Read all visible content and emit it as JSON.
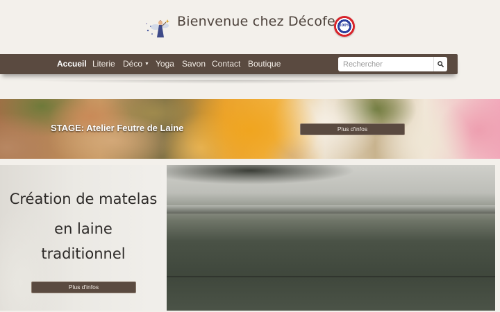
{
  "header": {
    "site_title": "Bienvenue chez Décofee",
    "logo_icon": "fairy-logo-icon",
    "badge_icon": "made-in-france-badge-icon",
    "badge_text": "100%"
  },
  "navbar": {
    "items": [
      {
        "label": "Accueil",
        "active": true
      },
      {
        "label": "Literie",
        "active": false
      },
      {
        "label": "Déco",
        "active": false,
        "has_dropdown": true
      },
      {
        "label": "Yoga",
        "active": false
      },
      {
        "label": "Savon",
        "active": false
      },
      {
        "label": "Contact",
        "active": false
      },
      {
        "label": "Boutique",
        "active": false
      }
    ],
    "search": {
      "placeholder": "Rechercher",
      "value": "",
      "icon": "search-icon"
    }
  },
  "banners": {
    "stage": {
      "label": "STAGE:  Atelier Feutre de Laine",
      "button": "Plus d'infos"
    },
    "matelas": {
      "lines": [
        "Création de matelas",
        "en laine",
        "traditionnel"
      ],
      "button": "Plus d'infos"
    }
  },
  "colors": {
    "page_bg": "#f3f0eb",
    "navbar_bg": "#5a4a40",
    "title_text": "#4d423b"
  }
}
